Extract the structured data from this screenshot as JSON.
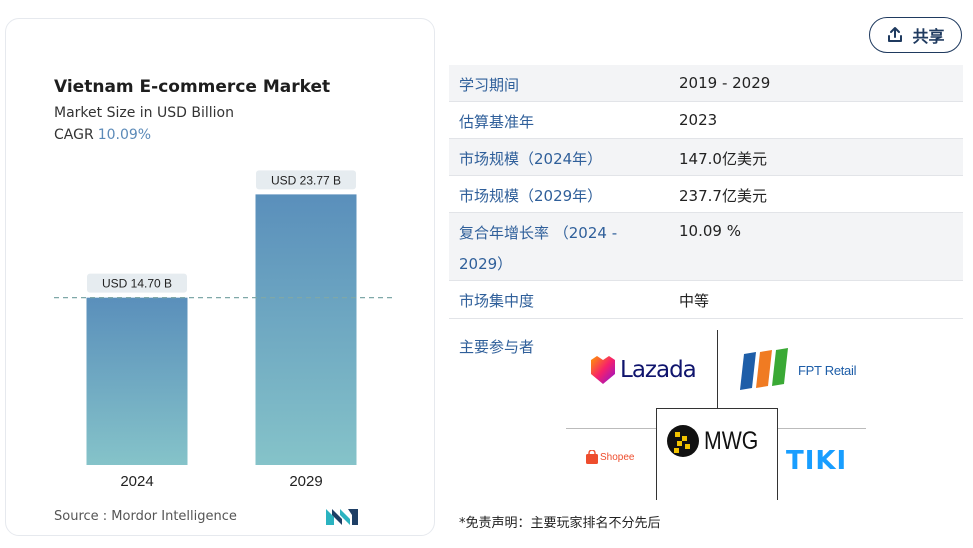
{
  "header": {
    "share_label": "共享"
  },
  "chart_data": {
    "type": "bar",
    "title": "Vietnam E-commerce Market",
    "subtitle": "Market Size in USD Billion",
    "cagr_label": "CAGR",
    "cagr_value": "10.09%",
    "categories": [
      "2024",
      "2029"
    ],
    "values": [
      14.7,
      23.77
    ],
    "data_labels": [
      "USD 14.70 B",
      "USD 23.77 B"
    ],
    "reference_line_value": 14.7,
    "ylim": [
      0,
      26
    ],
    "xlabel": "",
    "ylabel": "",
    "grid": false,
    "bar_colors": [
      "#5a8fbb",
      "#85c3c9"
    ],
    "source": "Source :  Mordor Intelligence"
  },
  "info_table": [
    {
      "label": "学习期间",
      "value": "2019 - 2029"
    },
    {
      "label": "估算基准年",
      "value": "2023"
    },
    {
      "label": "市场规模（2024年）",
      "value": "147.0亿美元"
    },
    {
      "label": "市场规模（2029年）",
      "value": "237.7亿美元"
    },
    {
      "label": "复合年增长率 （2024 -",
      "label_line2": "2029）",
      "value": "10.09 %"
    },
    {
      "label": "市场集中度",
      "value": "中等"
    }
  ],
  "players": {
    "label": "主要参与者",
    "logos": [
      "Lazada",
      "FPT Retail",
      "Shopee",
      "MWG",
      "TIKI"
    ]
  },
  "disclaimer": "*免责声明：主要玩家排名不分先后",
  "colors": {
    "accent": "#2f5f9a",
    "tiki": "#189eff",
    "lazada_text": "#0f146d",
    "fpt_blue": "#1e5ea8",
    "fpt_green": "#3aa935",
    "fpt_orange": "#f07b22",
    "shopee": "#ee4d2d"
  }
}
